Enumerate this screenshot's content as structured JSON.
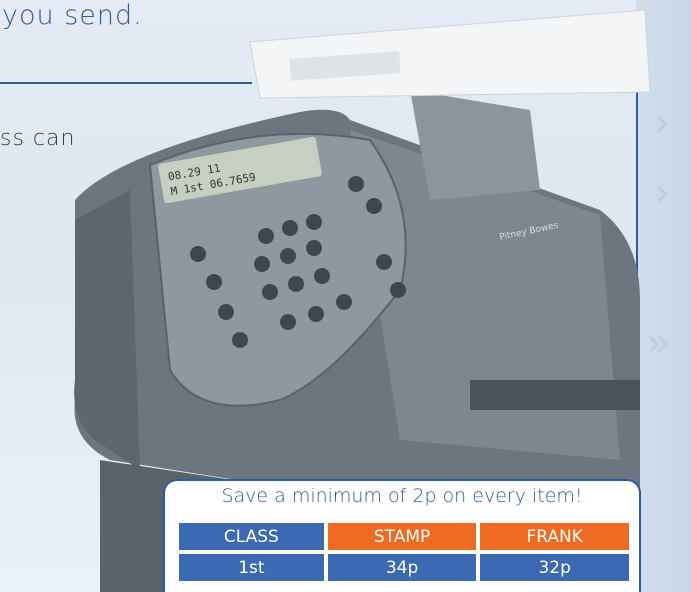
{
  "headline_fragment": "you send.",
  "body_fragment": "ss can",
  "savings_box": {
    "title": "Save a minimum of 2p on every item!",
    "headers": [
      "CLASS",
      "STAMP",
      "FRANK"
    ],
    "rows": [
      [
        "1st",
        "34p",
        "32p"
      ]
    ]
  },
  "device": {
    "lcd_line1": "08.29          11",
    "lcd_line2": "M 1st     06.7659",
    "brand_label": "Pitney Bowes"
  },
  "colors": {
    "brand_blue": "#2d5aa2",
    "header_blue": "#3b69b2",
    "header_orange": "#ef6a22",
    "device_gray": "#6e7880"
  }
}
